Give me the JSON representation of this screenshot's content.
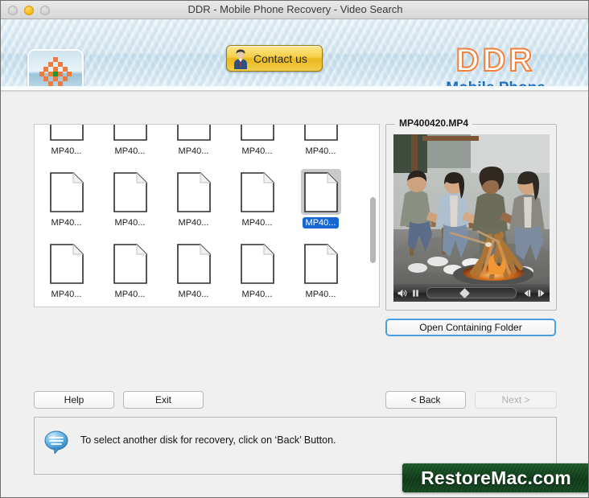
{
  "window": {
    "title": "DDR - Mobile Phone Recovery - Video Search",
    "traffic_lights": [
      "close-gray",
      "minimize-amber",
      "zoom-gray"
    ]
  },
  "header": {
    "contact_button": "Contact us",
    "brand_title": "DDR",
    "brand_subtitle": "Mobile Phone",
    "brand_color": "#f4803a",
    "brand_sub_color": "#1f6fc4"
  },
  "file_list": {
    "rows": [
      {
        "cells": [
          {
            "label": "MP40...",
            "selected": false
          },
          {
            "label": "MP40...",
            "selected": false
          },
          {
            "label": "MP40...",
            "selected": false
          },
          {
            "label": "MP40...",
            "selected": false
          },
          {
            "label": "MP40...",
            "selected": false
          }
        ]
      },
      {
        "cells": [
          {
            "label": "MP40...",
            "selected": false
          },
          {
            "label": "MP40...",
            "selected": false
          },
          {
            "label": "MP40...",
            "selected": false
          },
          {
            "label": "MP40...",
            "selected": false
          },
          {
            "label": "MP40...",
            "selected": true
          }
        ]
      },
      {
        "cells": [
          {
            "label": "MP40...",
            "selected": false
          },
          {
            "label": "MP40...",
            "selected": false
          },
          {
            "label": "MP40...",
            "selected": false
          },
          {
            "label": "MP40...",
            "selected": false
          },
          {
            "label": "MP40...",
            "selected": false
          }
        ]
      },
      {
        "cells": [
          {
            "label": "",
            "selected": false
          },
          {
            "label": "",
            "selected": false
          },
          {
            "label": "",
            "selected": false
          },
          {
            "label": "",
            "selected": false
          },
          {
            "label": "",
            "selected": false
          }
        ]
      }
    ],
    "selection_color": "#1767d2"
  },
  "preview": {
    "file_name": "MP400420.MP4",
    "open_folder_button": "Open Containing Folder",
    "player": {
      "volume_icon": "speaker-icon",
      "pause_icon": "pause-icon",
      "step_back_icon": "step-back-icon",
      "step_forward_icon": "step-forward-icon",
      "scrubber_position_percent": 38
    }
  },
  "footer": {
    "help_button": "Help",
    "exit_button": "Exit",
    "back_button": "< Back",
    "next_button": "Next >",
    "next_disabled": true
  },
  "status": {
    "message": "To select another disk for recovery, click on ‘Back’ Button.",
    "icon": "speech-bubble-icon"
  },
  "watermark": {
    "text": "RestoreMac.com",
    "background_color": "#0d3a17"
  }
}
